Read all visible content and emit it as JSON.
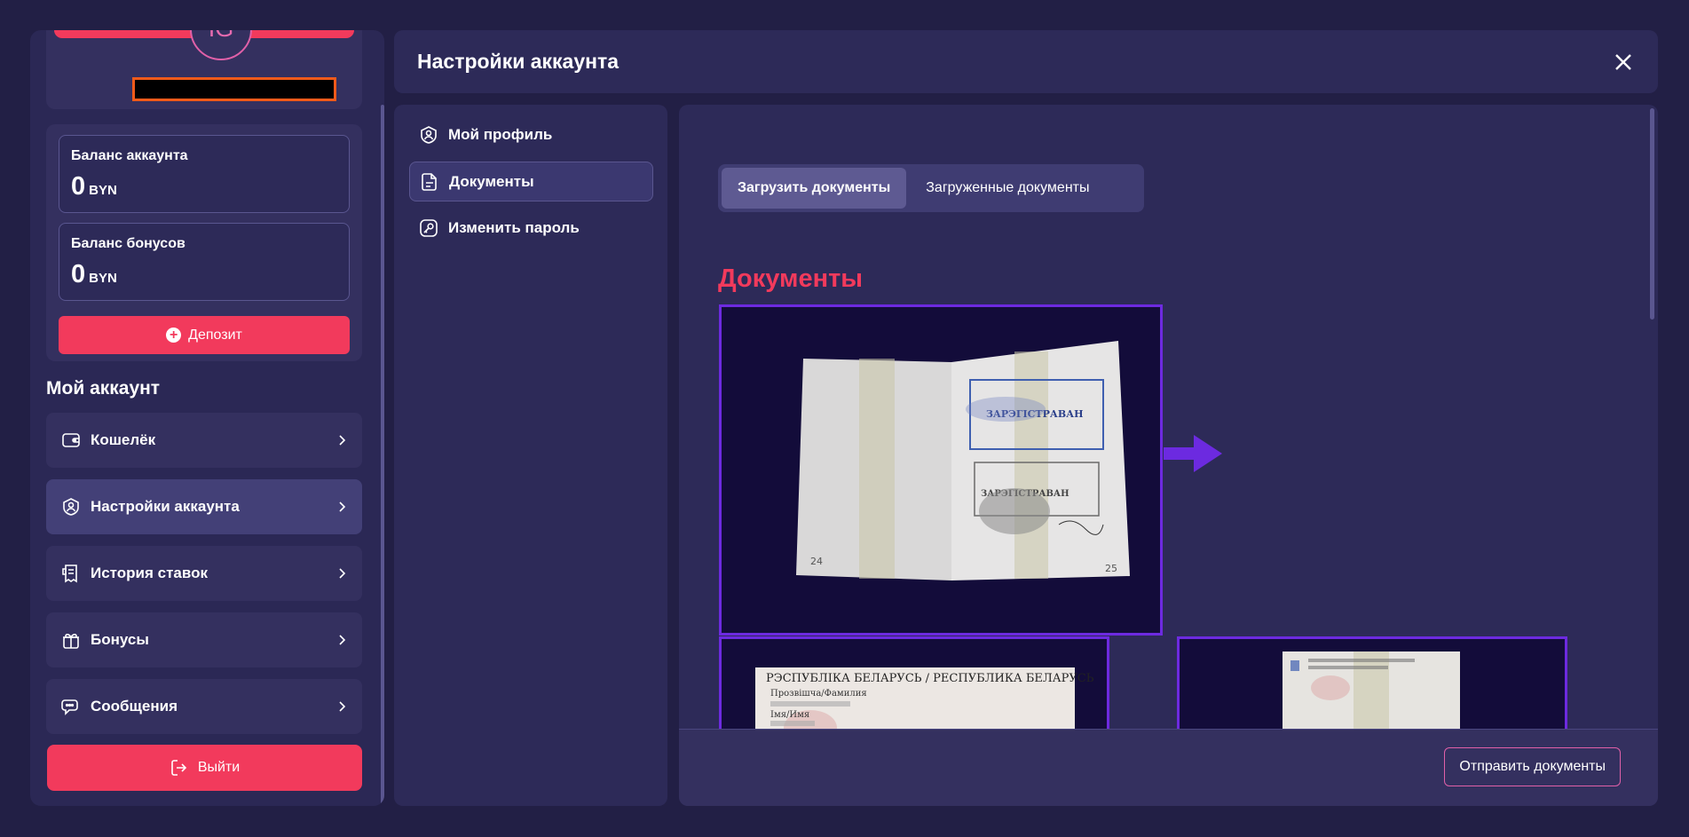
{
  "profile": {
    "avatar_text": "IG"
  },
  "balances": {
    "account_label": "Баланс аккаунта",
    "account_amount": "0",
    "account_currency": "BYN",
    "bonus_label": "Баланс бонусов",
    "bonus_amount": "0",
    "bonus_currency": "BYN",
    "deposit_label": "Депозит"
  },
  "my_account": {
    "title": "Мой аккаунт",
    "items": [
      {
        "label": "Кошелёк",
        "icon": "wallet-icon"
      },
      {
        "label": "Настройки аккаунта",
        "icon": "user-settings-icon",
        "active": true
      },
      {
        "label": "История ставок",
        "icon": "receipt-icon"
      },
      {
        "label": "Бонусы",
        "icon": "gift-icon"
      },
      {
        "label": "Сообщения",
        "icon": "chat-icon"
      }
    ],
    "logout_label": "Выйти"
  },
  "settings": {
    "title": "Настройки аккаунта",
    "nav": [
      {
        "label": "Мой профиль",
        "icon": "profile-icon"
      },
      {
        "label": "Документы",
        "icon": "document-icon",
        "active": true
      },
      {
        "label": "Изменить пароль",
        "icon": "key-icon"
      }
    ],
    "tabs": [
      {
        "label": "Загрузить документы",
        "active": true
      },
      {
        "label": "Загруженные документы"
      }
    ],
    "documents_title": "Документы",
    "submit_label": "Отправить документы"
  },
  "passport_sample": {
    "page_left": "24",
    "page_right": "25",
    "stamp_top": "ЗАРЭГІСТРАВАН",
    "stamp_bottom": "ЗАРЭГІСТРАВАН",
    "id_header": "РЭСПУБЛІКА БЕЛАРУСЬ / РЕСПУБЛИКА БЕЛАРУСЬ",
    "id_surname_label": "Прозвішча/Фамилия",
    "id_name_label": "Імя/Имя"
  },
  "colors": {
    "background": "#221f45",
    "panel": "#2d2a58",
    "accent": "#f23a5c",
    "frame": "#6d2ae0",
    "arrow": "#6c2ae0"
  }
}
